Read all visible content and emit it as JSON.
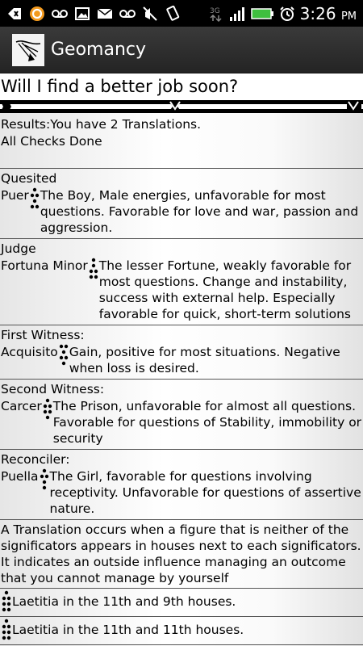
{
  "status_bar": {
    "time": "3:26",
    "ampm": "PM",
    "icons": [
      "back-icon",
      "reload-icon",
      "voicemail-icon",
      "gallery-icon",
      "mail-icon",
      "voicemail-icon",
      "mute-icon",
      "rotate-icon",
      "3g-icon",
      "signal-icon",
      "battery-icon",
      "alarm-icon"
    ]
  },
  "app": {
    "title": "Geomancy"
  },
  "question": "Will I find a better job soon?",
  "results": {
    "line1": "Results:You have 2 Translations.",
    "line2": "All Checks Done"
  },
  "sections": [
    {
      "label": "Quesited",
      "name": "Puer",
      "description": "The Boy, Male energies, unfavorable for most questions. Favorable for love and war, passion and aggression."
    },
    {
      "label": "Judge",
      "name": "Fortuna Minor",
      "description": "The lesser Fortune, weakly favorable for most questions.  Change and instability, success with external help. Especially favorable for quick, short-term solutions"
    },
    {
      "label": "First Witness:",
      "name": "Acquisito",
      "description": "Gain, positive for most situations. Negative when loss is desired."
    },
    {
      "label": "Second Witness:",
      "name": "Carcer",
      "description": "The Prison, unfavorable for almost all questions. Favorable for questions of Stability, immobility or security"
    },
    {
      "label": "Reconciler:",
      "name": "Puella",
      "description": "The Girl, favorable for questions involving receptivity. Unfavorable for questions of assertive nature."
    }
  ],
  "translation_note": "A Translation occurs when a figure that is neither of the significators appears in houses next to each significators. It indicates an outside influence managing an outcome that you cannot manage by yourself",
  "translations": [
    "Laetitia in the 11th and 9th houses.",
    "Laetitia in the 11th and 11th houses."
  ]
}
